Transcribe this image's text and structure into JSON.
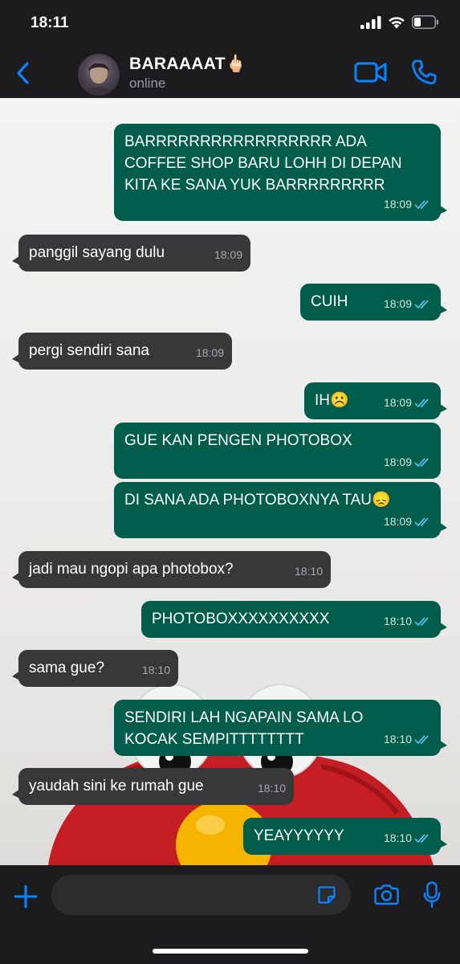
{
  "status_bar": {
    "time": "18:11",
    "icons": [
      "signal-icon",
      "wifi-icon",
      "battery-icon"
    ]
  },
  "header": {
    "contact_name": "BARAAAAT",
    "name_emoji": "🖕🏻",
    "status": "online",
    "icons": [
      "back-chevron-icon",
      "video-call-icon",
      "phone-call-icon"
    ],
    "accent_color": "#0a84ff"
  },
  "messages": [
    {
      "dir": "out",
      "text": "BARRRRRRRRRRRRRRRRR ADA\nCOFFEE SHOP BARU LOHH DI DEPAN\nKITA KE SANA YUK BARRRRRRRRR",
      "time": "18:09",
      "status": "read"
    },
    {
      "dir": "in",
      "text": "panggil sayang dulu",
      "time": "18:09"
    },
    {
      "dir": "out",
      "text": "CUIH",
      "time": "18:09",
      "status": "read"
    },
    {
      "dir": "in",
      "text": "pergi sendiri sana",
      "time": "18:09"
    },
    {
      "dir": "out",
      "text": "IH☹️",
      "time": "18:09",
      "status": "read"
    },
    {
      "dir": "out",
      "text": "GUE KAN PENGEN PHOTOBOX",
      "time": "18:09",
      "status": "read"
    },
    {
      "dir": "out",
      "text": "DI SANA ADA PHOTOBOXNYA TAU😞",
      "time": "18:09",
      "status": "read"
    },
    {
      "dir": "in",
      "text": "jadi mau ngopi apa photobox?",
      "time": "18:10"
    },
    {
      "dir": "out",
      "text": "PHOTOBOXXXXXXXXXX",
      "time": "18:10",
      "status": "read"
    },
    {
      "dir": "in",
      "text": "sama gue?",
      "time": "18:10"
    },
    {
      "dir": "out",
      "text": "SENDIRI LAH NGAPAIN SAMA LO\nKOCAK SEMPITTTTTTTT",
      "time": "18:10",
      "status": "read"
    },
    {
      "dir": "in",
      "text": "yaudah sini ke rumah gue",
      "time": "18:10"
    },
    {
      "dir": "out",
      "text": "YEAYYYYYY",
      "time": "18:10",
      "status": "read"
    }
  ],
  "input_bar": {
    "icons": [
      "plus-icon",
      "sticker-icon",
      "camera-icon",
      "microphone-icon"
    ]
  },
  "colors": {
    "outgoing_bubble": "#005c4b",
    "incoming_bubble": "#38383b",
    "read_tick": "#53bdeb",
    "bars": "#1c1c1e"
  }
}
